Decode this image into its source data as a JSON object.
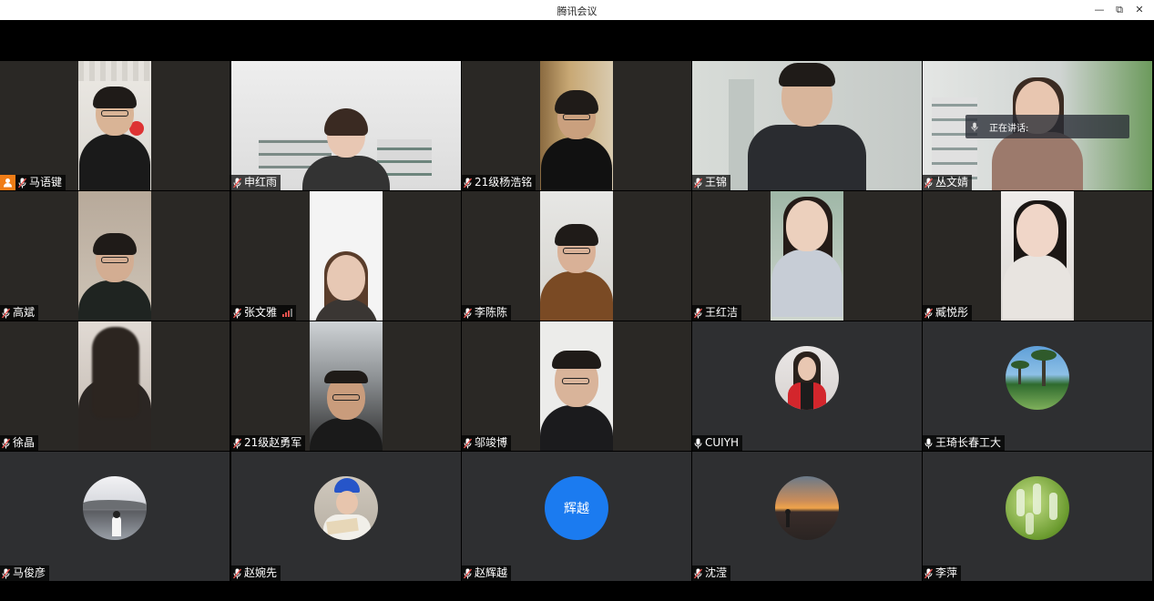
{
  "window": {
    "title": "腾讯会议",
    "controls": {
      "minimize": "—",
      "restore": "⧉",
      "close": "✕"
    }
  },
  "speaking_panel": {
    "label": "正在讲话:"
  },
  "participants": [
    {
      "name": "马语键",
      "host": true
    },
    {
      "name": "申红雨"
    },
    {
      "name": "21级杨浩铭"
    },
    {
      "name": "王锦"
    },
    {
      "name": "丛文婧"
    },
    {
      "name": "高斌"
    },
    {
      "name": "张文雅",
      "signal": "weak"
    },
    {
      "name": "李陈陈"
    },
    {
      "name": "王红洁"
    },
    {
      "name": "臧悦彤"
    },
    {
      "name": "徐晶"
    },
    {
      "name": "21级赵勇军"
    },
    {
      "name": "邬竣博"
    },
    {
      "name": "CUIYH",
      "mic": "on"
    },
    {
      "name": "王琦长春工大",
      "mic": "on"
    },
    {
      "name": "马俊彦"
    },
    {
      "name": "赵婉先"
    },
    {
      "name": "赵辉越",
      "avatar_text": "辉越"
    },
    {
      "name": "沈滢"
    },
    {
      "name": "李萍"
    }
  ],
  "colors": {
    "tile_bg": "#2a2825",
    "accent_blue": "#1b7bf0",
    "host_orange": "#f07d17",
    "muted_red": "#e9514d"
  }
}
